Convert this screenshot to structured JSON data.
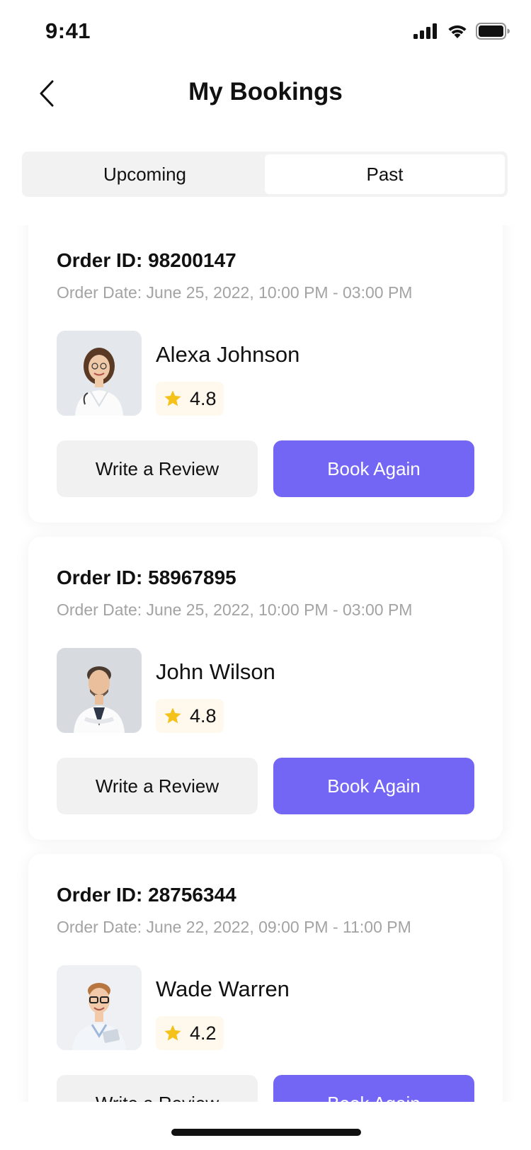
{
  "status_bar": {
    "time": "9:41"
  },
  "header": {
    "title": "My Bookings"
  },
  "tabs": [
    {
      "label": "Upcoming",
      "active": false
    },
    {
      "label": "Past",
      "active": true
    }
  ],
  "bookings": [
    {
      "order_id": "Order ID: 98200147",
      "order_date": "Order Date: June 25, 2022, 10:00 PM - 03:00 PM",
      "doctor_name": "Alexa Johnson",
      "rating": "4.8",
      "review_label": "Write a Review",
      "book_label": "Book Again"
    },
    {
      "order_id": "Order ID: 58967895",
      "order_date": "Order Date: June 25, 2022, 10:00 PM - 03:00 PM",
      "doctor_name": "John Wilson",
      "rating": "4.8",
      "review_label": "Write a Review",
      "book_label": "Book Again"
    },
    {
      "order_id": "Order ID: 28756344",
      "order_date": "Order Date: June 22, 2022, 09:00 PM - 11:00 PM",
      "doctor_name": "Wade Warren",
      "rating": "4.2",
      "review_label": "Write a Review",
      "book_label": "Book Again"
    }
  ],
  "colors": {
    "accent": "#7366f5",
    "star": "#f5c21b",
    "secondary_button": "#f1f1f1",
    "muted_text": "#a3a3a3"
  },
  "icons": {
    "back": "chevron-left-icon",
    "signal": "cellular-signal-icon",
    "wifi": "wifi-icon",
    "battery": "battery-icon",
    "star": "star-icon"
  }
}
